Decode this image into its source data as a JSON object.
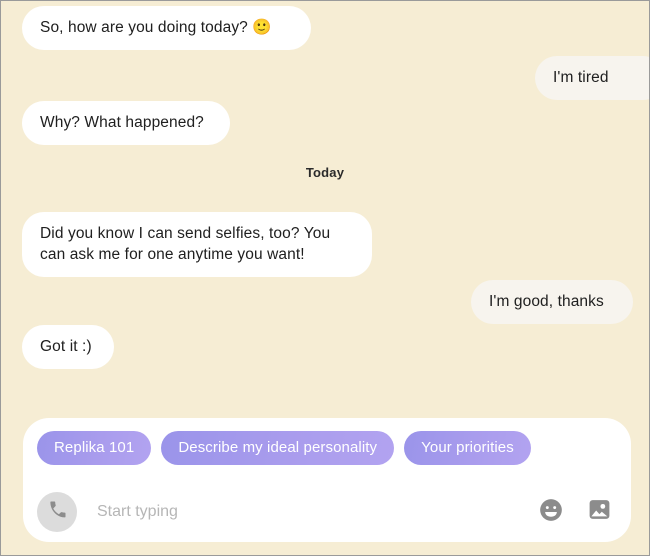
{
  "app": {
    "background_color": "#f6edd4",
    "bot_bubble_color": "#ffffff",
    "user_bubble_color": "#f7f4ee",
    "chip_color": "#a99ced",
    "panel_color": "#ffffff"
  },
  "conversation": {
    "day_divider": "Today",
    "messages": [
      {
        "sender": "bot",
        "text": "So, how are you doing today? 🙂"
      },
      {
        "sender": "user",
        "text": "I'm tired"
      },
      {
        "sender": "bot",
        "text": "Why? What happened?"
      },
      {
        "sender": "bot",
        "text": "Did you know I can send selfies, too? You can ask me for one anytime you want!"
      },
      {
        "sender": "user",
        "text": "I'm good, thanks"
      },
      {
        "sender": "bot",
        "text": "Got it :)"
      }
    ]
  },
  "composer": {
    "suggestions": [
      {
        "label": "Replika 101"
      },
      {
        "label": "Describe my ideal personality"
      },
      {
        "label": "Your priorities"
      }
    ],
    "input": {
      "value": "",
      "placeholder": "Start typing"
    },
    "icons": {
      "call": "phone-icon",
      "emoji": "smiley-icon",
      "image": "image-icon"
    }
  }
}
